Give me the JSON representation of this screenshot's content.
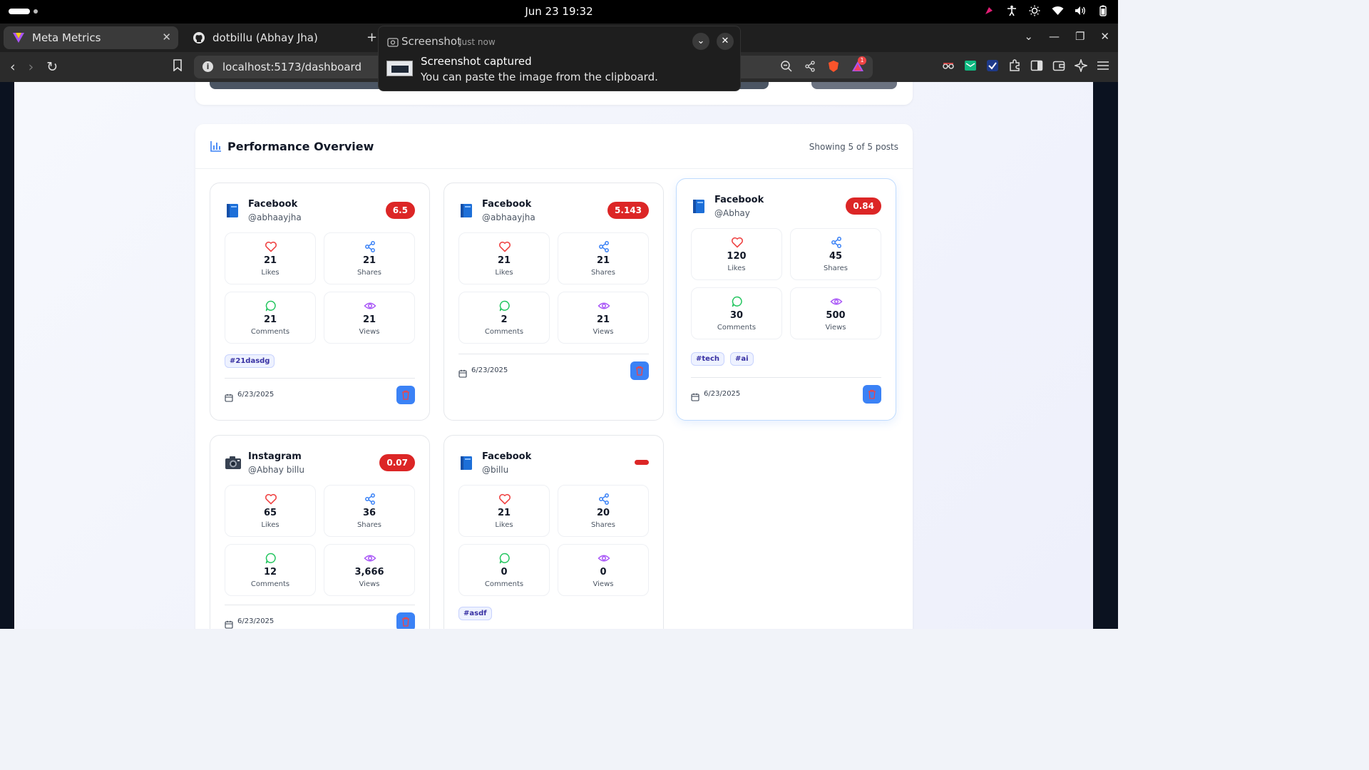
{
  "os": {
    "clock": "Jun 23  19:32"
  },
  "browser": {
    "tabs": [
      {
        "label": "Meta Metrics"
      },
      {
        "label": "dotbillu (Abhay Jha)"
      }
    ],
    "url": "localhost:5173/dashboard",
    "notification_count": "1"
  },
  "notification": {
    "app": "Screenshot",
    "time": "Just now",
    "title": "Screenshot captured",
    "body": "You can paste the image from the clipboard."
  },
  "overview": {
    "title": "Performance Overview",
    "count": "Showing 5 of 5 posts"
  },
  "posts": [
    {
      "platform": "Facebook",
      "handle": "@abhaayjha",
      "score": "6.5",
      "likes": "21",
      "shares": "21",
      "comments": "21",
      "views": "21",
      "tags": [
        "#21dasdg"
      ],
      "date": "6/23/2025"
    },
    {
      "platform": "Facebook",
      "handle": "@abhaayjha",
      "score": "5.143",
      "likes": "21",
      "shares": "21",
      "comments": "2",
      "views": "21",
      "tags": [],
      "date": "6/23/2025"
    },
    {
      "platform": "Facebook",
      "handle": "@Abhay",
      "score": "0.84",
      "likes": "120",
      "shares": "45",
      "comments": "30",
      "views": "500",
      "tags": [
        "#tech",
        "#ai"
      ],
      "date": "6/23/2025"
    },
    {
      "platform": "Instagram",
      "handle": "@Abhay billu",
      "score": "0.07",
      "likes": "65",
      "shares": "36",
      "comments": "12",
      "views": "3,666",
      "tags": [],
      "date": "6/23/2025"
    },
    {
      "platform": "Facebook",
      "handle": "@billu",
      "score": "",
      "likes": "21",
      "shares": "20",
      "comments": "0",
      "views": "0",
      "tags": [
        "#asdf"
      ],
      "date": ""
    }
  ],
  "labels": {
    "likes": "Likes",
    "shares": "Shares",
    "comments": "Comments",
    "views": "Views"
  },
  "colors": {
    "likes": "#ef4444",
    "shares": "#3b82f6",
    "comments": "#22c55e",
    "views": "#a855f7",
    "badge": "#dc2626",
    "delete": "#3b82f6"
  },
  "icons": {
    "likes": "heart-icon",
    "shares": "share-icon",
    "comments": "comment-icon",
    "views": "eye-icon",
    "date": "calendar-icon",
    "delete": "trash-icon",
    "facebook": "book-icon",
    "instagram": "camera-icon"
  }
}
